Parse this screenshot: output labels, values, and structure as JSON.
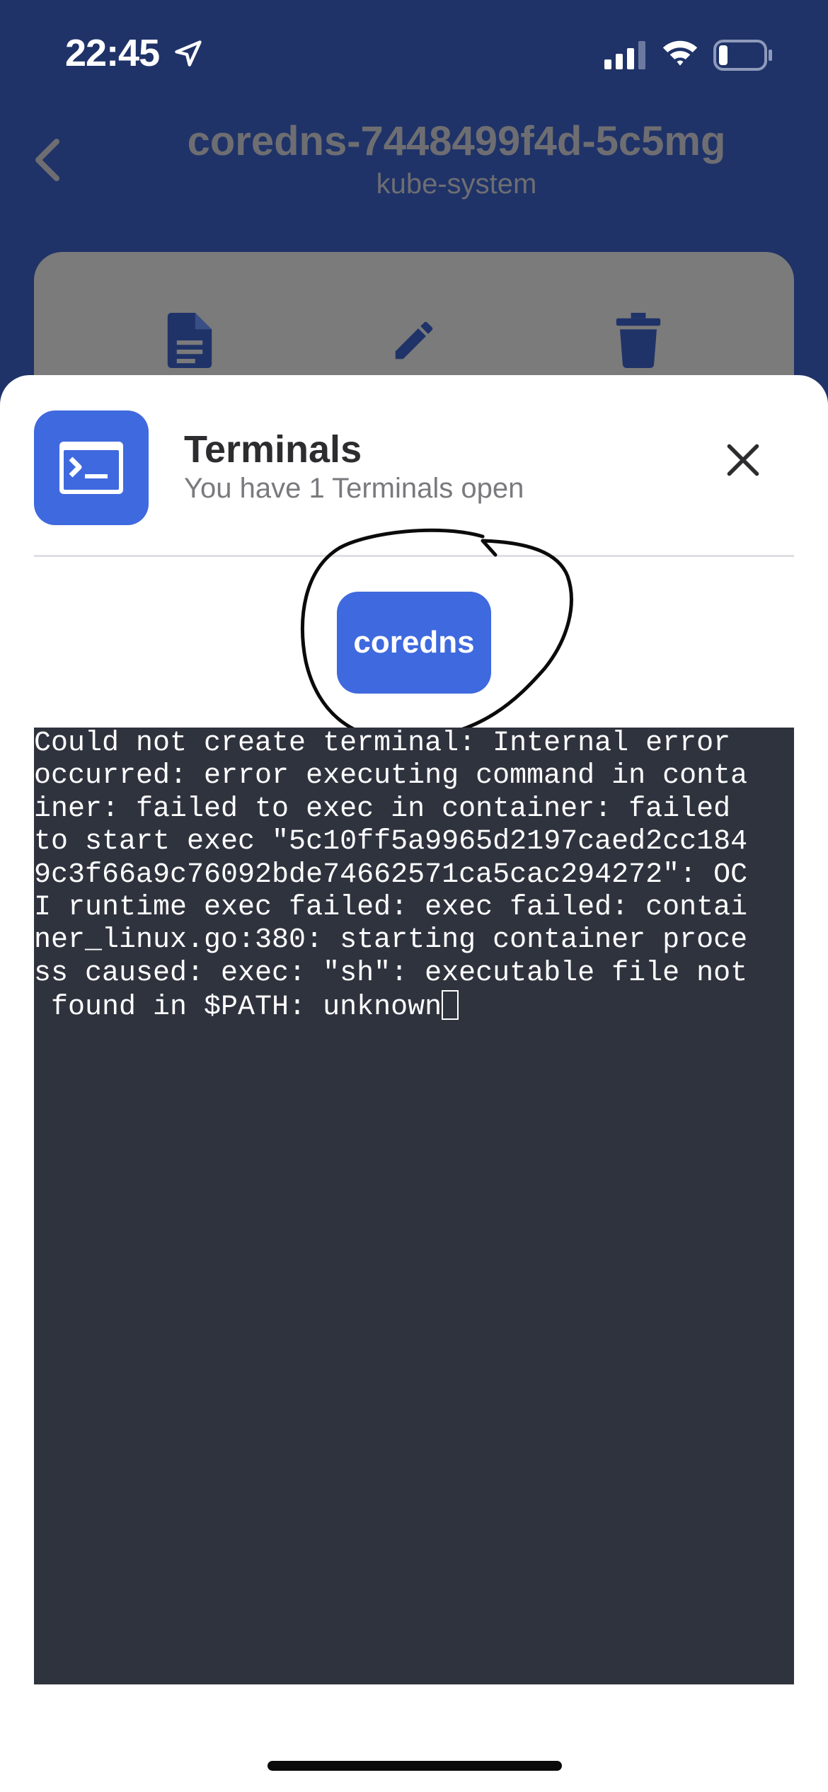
{
  "status_bar": {
    "time": "22:45",
    "icons": [
      "location-arrow-icon",
      "signal-icon",
      "wifi-icon",
      "battery-icon"
    ]
  },
  "header": {
    "pod_name": "coredns-7448499f4d-5c5mg",
    "namespace": "kube-system",
    "actions": [
      "document-icon",
      "edit-icon",
      "trash-icon"
    ]
  },
  "sheet": {
    "title": "Terminals",
    "subtitle": "You have 1 Terminals open",
    "tabs": [
      {
        "label": "coredns"
      }
    ]
  },
  "terminal": {
    "lines": [
      "Could not create terminal: Internal error",
      "occurred: error executing command in conta",
      "iner: failed to exec in container: failed",
      "to start exec \"5c10ff5a9965d2197caed2cc184",
      "9c3f66a9c76092bde74662571ca5cac294272\": OC",
      "I runtime exec failed: exec failed: contai",
      "ner_linux.go:380: starting container proce",
      "ss caused: exec: \"sh\": executable file not",
      " found in $PATH: unknown"
    ]
  },
  "colors": {
    "background": "#1f3368",
    "accent": "#3f69de",
    "terminal_bg": "#2f333e"
  }
}
